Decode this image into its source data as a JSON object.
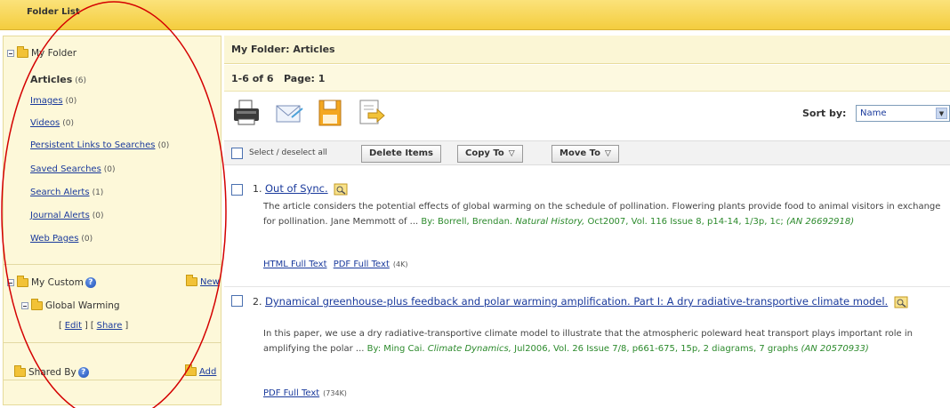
{
  "header": {
    "title": "Folder List"
  },
  "sidebar": {
    "my_folder": "My Folder",
    "items": [
      {
        "label": "Articles",
        "count": "(6)"
      },
      {
        "label": "Images",
        "count": "(0)"
      },
      {
        "label": "Videos",
        "count": "(0)"
      },
      {
        "label": "Persistent Links to Searches",
        "count": "(0)"
      },
      {
        "label": "Saved Searches",
        "count": "(0)"
      },
      {
        "label": "Search Alerts",
        "count": "(1)"
      },
      {
        "label": "Journal Alerts",
        "count": "(0)"
      },
      {
        "label": "Web Pages",
        "count": "(0)"
      }
    ],
    "my_custom": "My Custom",
    "new_label": "New",
    "custom_folder": "Global Warming",
    "edit_label": "Edit",
    "share_label": "Share",
    "shared_by": "Shared By",
    "add_label": "Add"
  },
  "main": {
    "heading": "My Folder: Articles",
    "range": "1-6 of 6   Page: 1",
    "sort_label": "Sort by:",
    "sort_value": "Name",
    "select_all": "Select / deselect all",
    "delete_btn": "Delete Items",
    "copy_btn": "Copy To",
    "move_btn": "Move To",
    "results": [
      {
        "num": "1.",
        "title": "Out of Sync.",
        "abstract": "The article considers the potential effects of  global warming on the schedule of pollination.  Flowering plants provide food to animal visitors in exchange for pollination. Jane Memmott of ...",
        "by": "By: Borrell, Brendan.",
        "source": "Natural History,",
        "details": "Oct2007, Vol. 116 Issue 8, p14-14, 1/3p, 1c;",
        "an": "(AN 26692918)",
        "links": [
          "HTML Full Text",
          "PDF Full Text"
        ],
        "size": "(4K)"
      },
      {
        "num": "2.",
        "title": "Dynamical greenhouse-plus feedback and polar warming amplification. Part I: A dry radiative-transportive climate model.",
        "abstract": "In this paper, we use a dry radiative-transportive climate model to illustrate that the atmospheric poleward heat transport plays important role in amplifying the polar ...",
        "by": "By: Ming Cai.",
        "source": "Climate Dynamics,",
        "details": "Jul2006, Vol. 26 Issue 7/8, p661-675, 15p, 2 diagrams, 7 graphs",
        "an": "(AN 20570933)",
        "links": [
          "PDF Full Text"
        ],
        "size": "(734K)"
      }
    ]
  },
  "colors": {
    "header_bg": "#f4cd3e",
    "sidebar_bg": "#fdf8d9",
    "link": "#1a3a9c",
    "meta": "#2c8a2c",
    "annotation": "#d40000"
  },
  "icons": [
    "print-icon",
    "email-icon",
    "save-icon",
    "export-icon",
    "folder-icon",
    "help-icon",
    "view-icon"
  ]
}
